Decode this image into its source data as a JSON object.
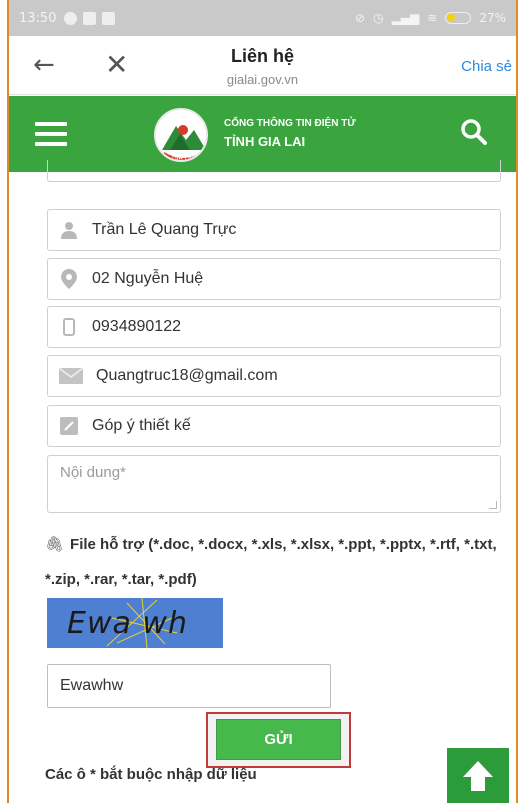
{
  "status_bar": {
    "time": "13:50",
    "battery": "27%"
  },
  "nav": {
    "title": "Liên hệ",
    "url": "gialai.gov.vn",
    "share_label": "Chia sẻ"
  },
  "header": {
    "brand_line1": "CỔNG THÔNG TIN ĐIỆN TỬ",
    "brand_line2": "TỈNH GIA LAI",
    "logo_text": "GIA LAI",
    "color": "#3aa53f"
  },
  "form": {
    "name_value": "Trần Lê Quang Trực",
    "address_value": "02 Nguyễn Huệ",
    "phone_value": "0934890122",
    "email_value": "Quangtruc18@gmail.com",
    "subject_value": "Góp ý thiết kế",
    "content_placeholder": "Nội dung*",
    "file_note": "File hỗ trợ (*.doc, *.docx, *.xls, *.xlsx, *.ppt, *.pptx, *.rtf, *.txt, *.zip, *.rar, *.tar, *.pdf)",
    "captcha_text": "Ewa wh w",
    "captcha_input_value": "Ewawhw",
    "submit_label": "GỬI",
    "required_note": "Các ô * bắt buộc nhập dữ liệu"
  },
  "icons": {
    "name": "user-icon",
    "address": "location-pin-icon",
    "phone": "phone-icon",
    "email": "envelope-icon",
    "subject": "edit-icon",
    "file": "paperclip-icon",
    "scroll_top": "arrow-up-icon",
    "menu": "hamburger-icon",
    "search": "search-icon"
  }
}
